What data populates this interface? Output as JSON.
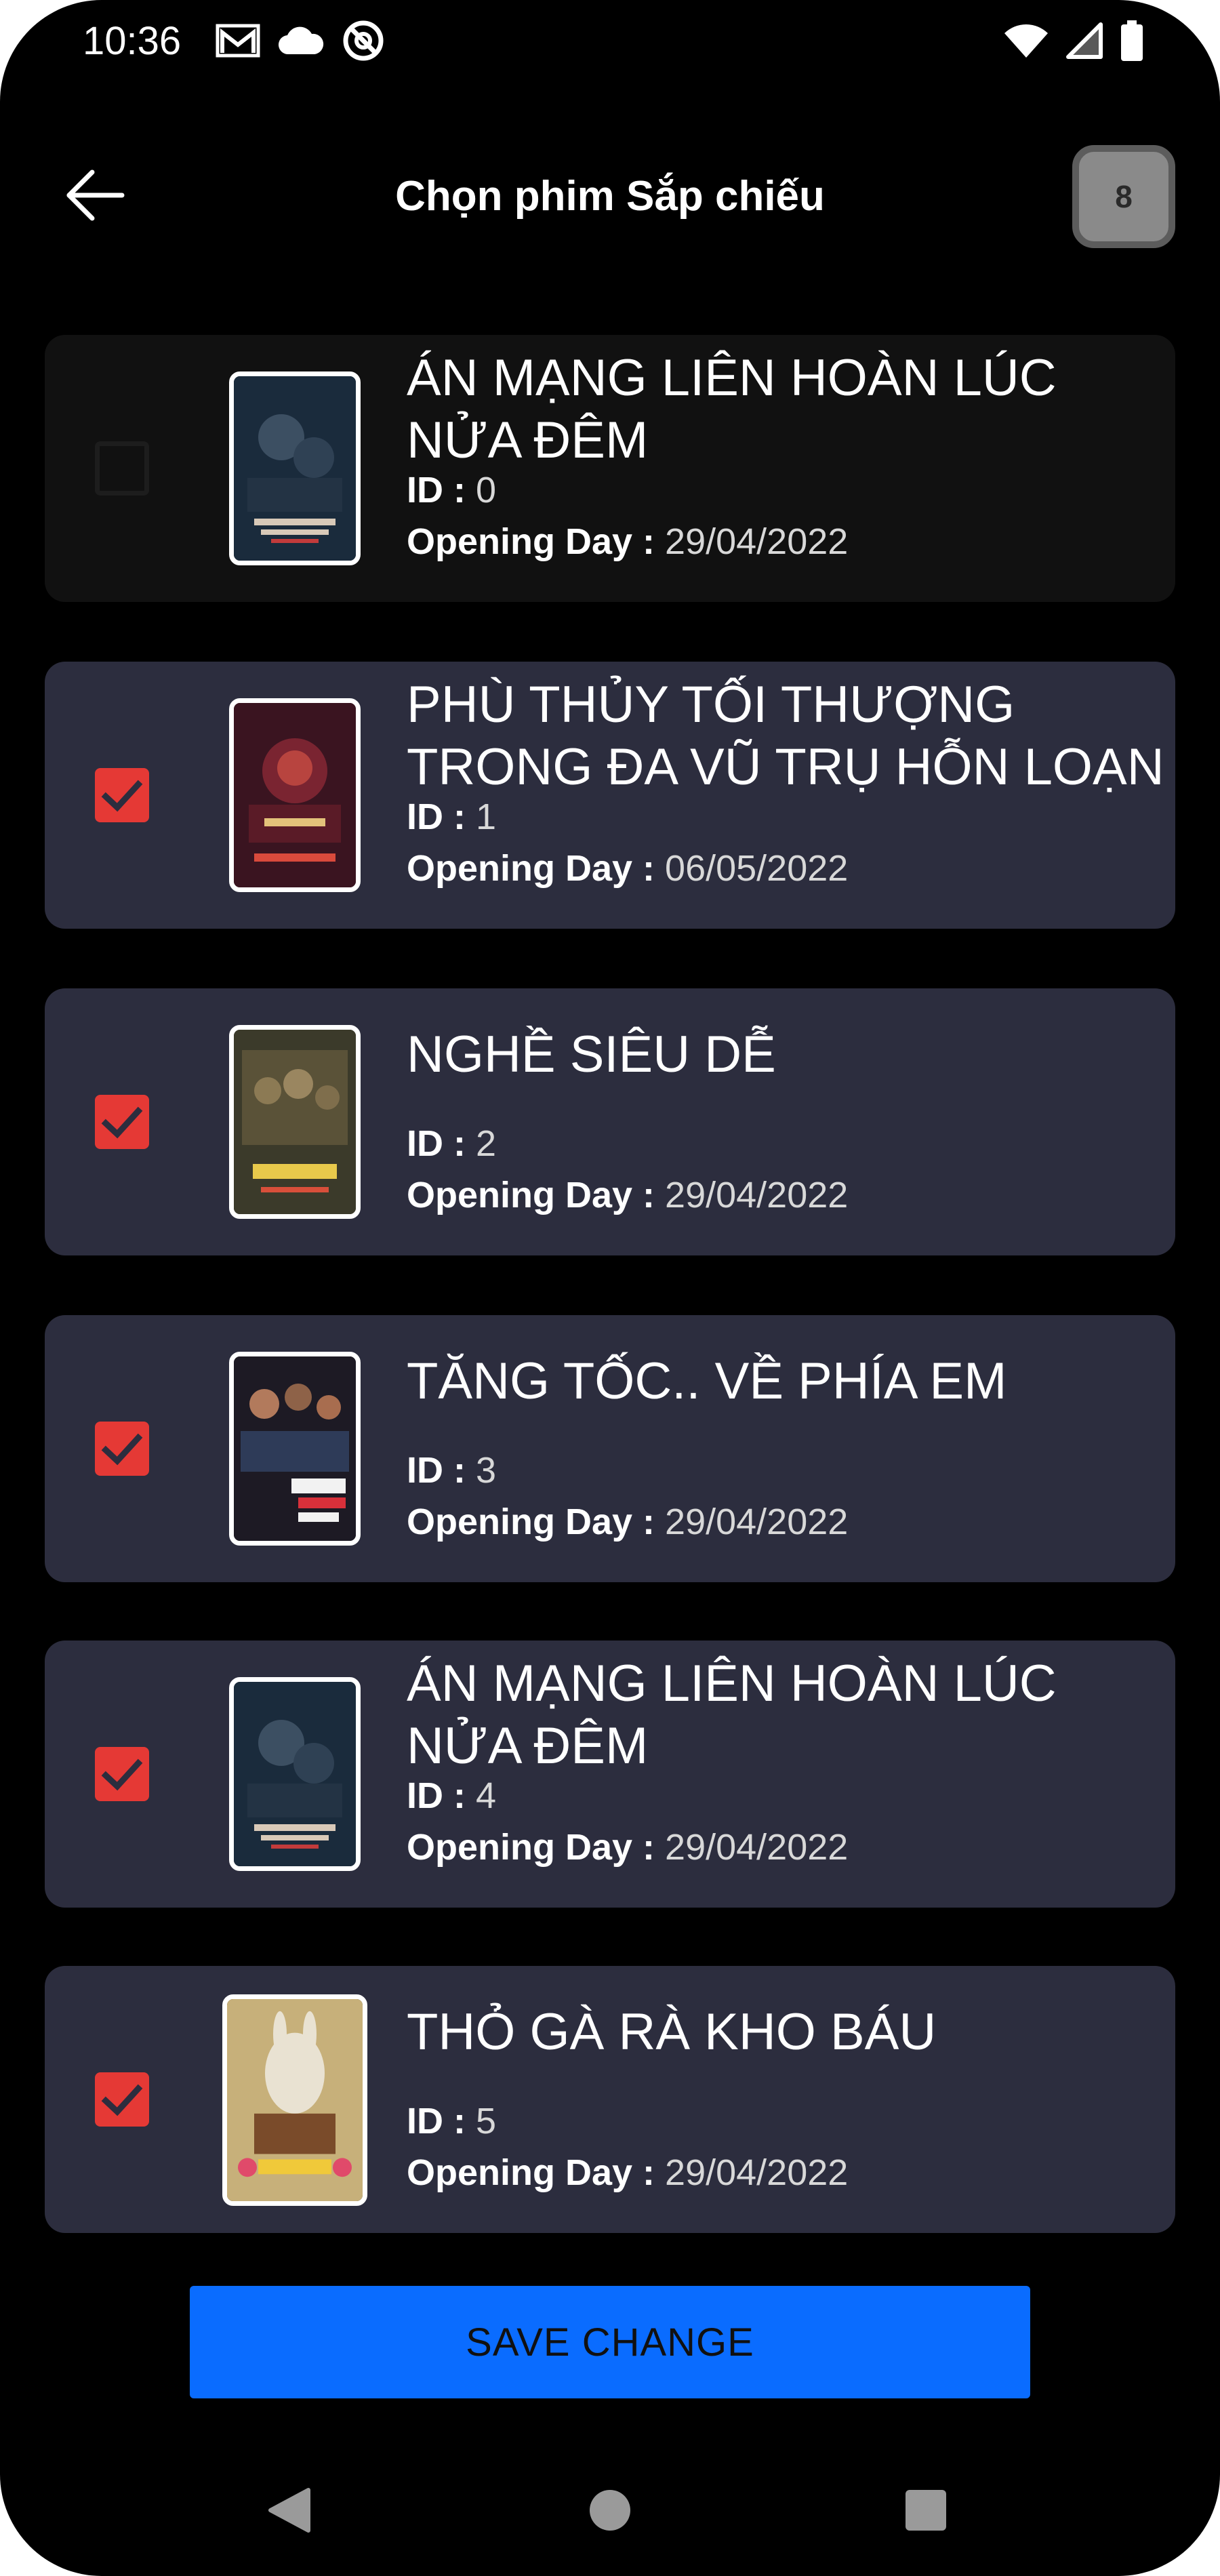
{
  "status_bar": {
    "time": "10:36",
    "left_icons": [
      "gmail-icon",
      "cloud-icon",
      "do-not-disturb-icon"
    ],
    "right_icons": [
      "wifi-icon",
      "signal-icon",
      "battery-icon"
    ]
  },
  "header": {
    "title": "Chọn phim Sắp chiếu",
    "back_icon": "arrow-left-icon",
    "count": "8"
  },
  "labels": {
    "id": "ID :",
    "opening_day": "Opening Day :"
  },
  "movies": [
    {
      "title": "ÁN MẠNG LIÊN HOÀN LÚC NỬA ĐÊM",
      "id": "0",
      "opening_day": "29/04/2022",
      "checked": false
    },
    {
      "title": "PHÙ THỦY TỐI THƯỢNG TRONG ĐA VŨ TRỤ HỖN LOẠN",
      "id": "1",
      "opening_day": "06/05/2022",
      "checked": true
    },
    {
      "title": "NGHỀ SIÊU DỄ",
      "id": "2",
      "opening_day": "29/04/2022",
      "checked": true
    },
    {
      "title": "TĂNG TỐC.. VỀ PHÍA EM",
      "id": "3",
      "opening_day": "29/04/2022",
      "checked": true
    },
    {
      "title": "ÁN MẠNG LIÊN HOÀN LÚC NỬA ĐÊM",
      "id": "4",
      "opening_day": "29/04/2022",
      "checked": true
    },
    {
      "title": "THỎ GÀ RÀ KHO BÁU",
      "id": "5",
      "opening_day": "29/04/2022",
      "checked": true
    }
  ],
  "save_button": {
    "label": "SAVE CHANGE"
  },
  "nav_bar": {
    "buttons": [
      "back-triangle-icon",
      "home-circle-icon",
      "recents-square-icon"
    ]
  },
  "colors": {
    "background": "#000000",
    "card": "#2c2d3e",
    "card_unchecked": "#111111",
    "checkbox": "#e53935",
    "primary_button": "#0a6cff"
  }
}
